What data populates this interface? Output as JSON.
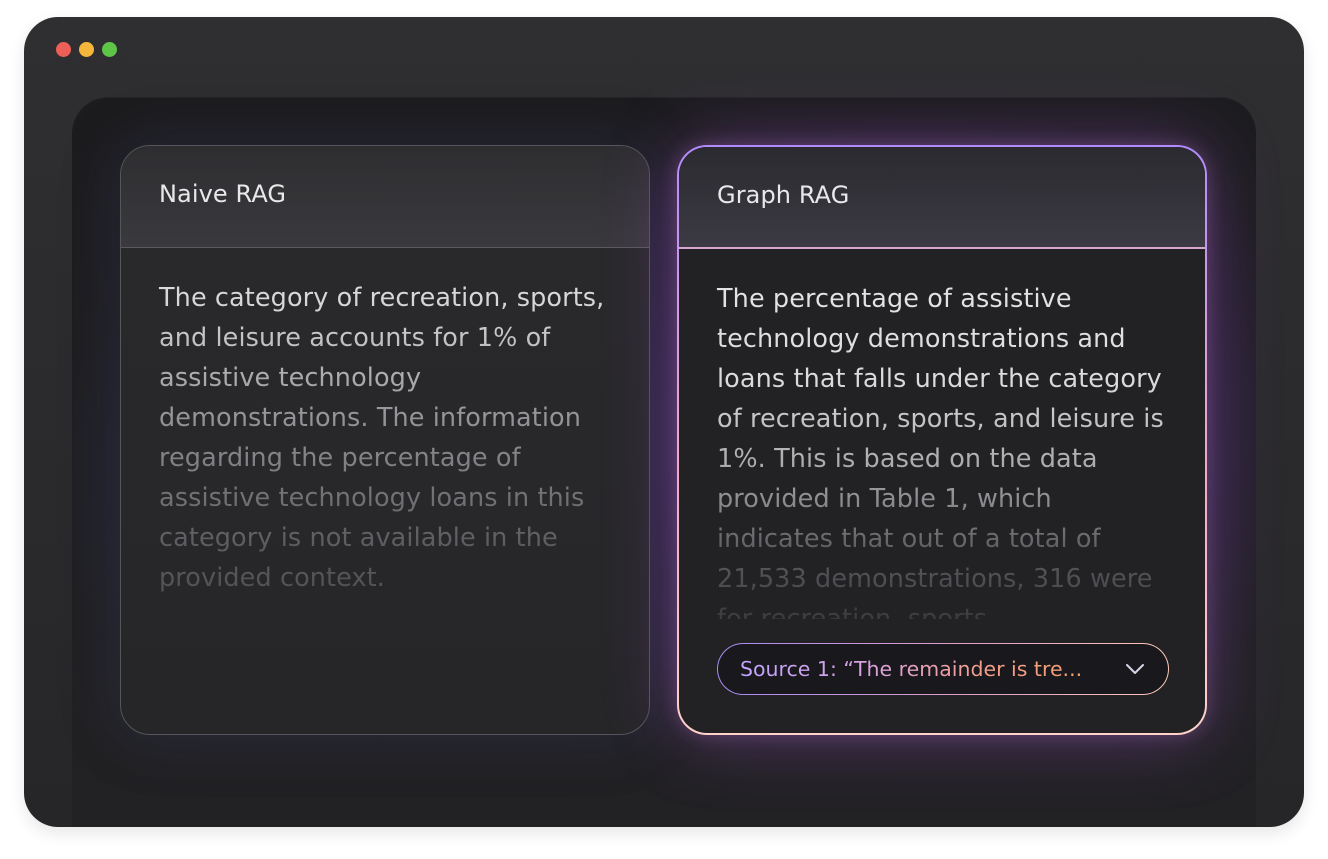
{
  "window": {
    "controls": [
      "close",
      "minimize",
      "maximize"
    ]
  },
  "naive_card": {
    "title": "Naive RAG",
    "body": "The category of recreation, sports, and leisure accounts for 1% of assistive technology demonstrations. The information regarding the  percentage of assistive technology loans in this category is not  available in the provided context."
  },
  "graph_card": {
    "title": "Graph RAG",
    "body": "The percentage of assistive technology demonstrations and loans  that falls under the category of recreation, sports, and leisure is 1%.  This is based on the data provided in Table 1, which indicates that out  of a total of 21,533 demonstrations, 316 were for recreation, sports,...",
    "source": {
      "label": "Source 1: “The remainder is tre...",
      "icon": "chevron-down-icon"
    }
  },
  "colors": {
    "close": "#ee5f57",
    "minimize": "#f4b73c",
    "maximize": "#5fc549",
    "accent_purple": "#b28cff",
    "accent_orange": "#f6a06a"
  }
}
